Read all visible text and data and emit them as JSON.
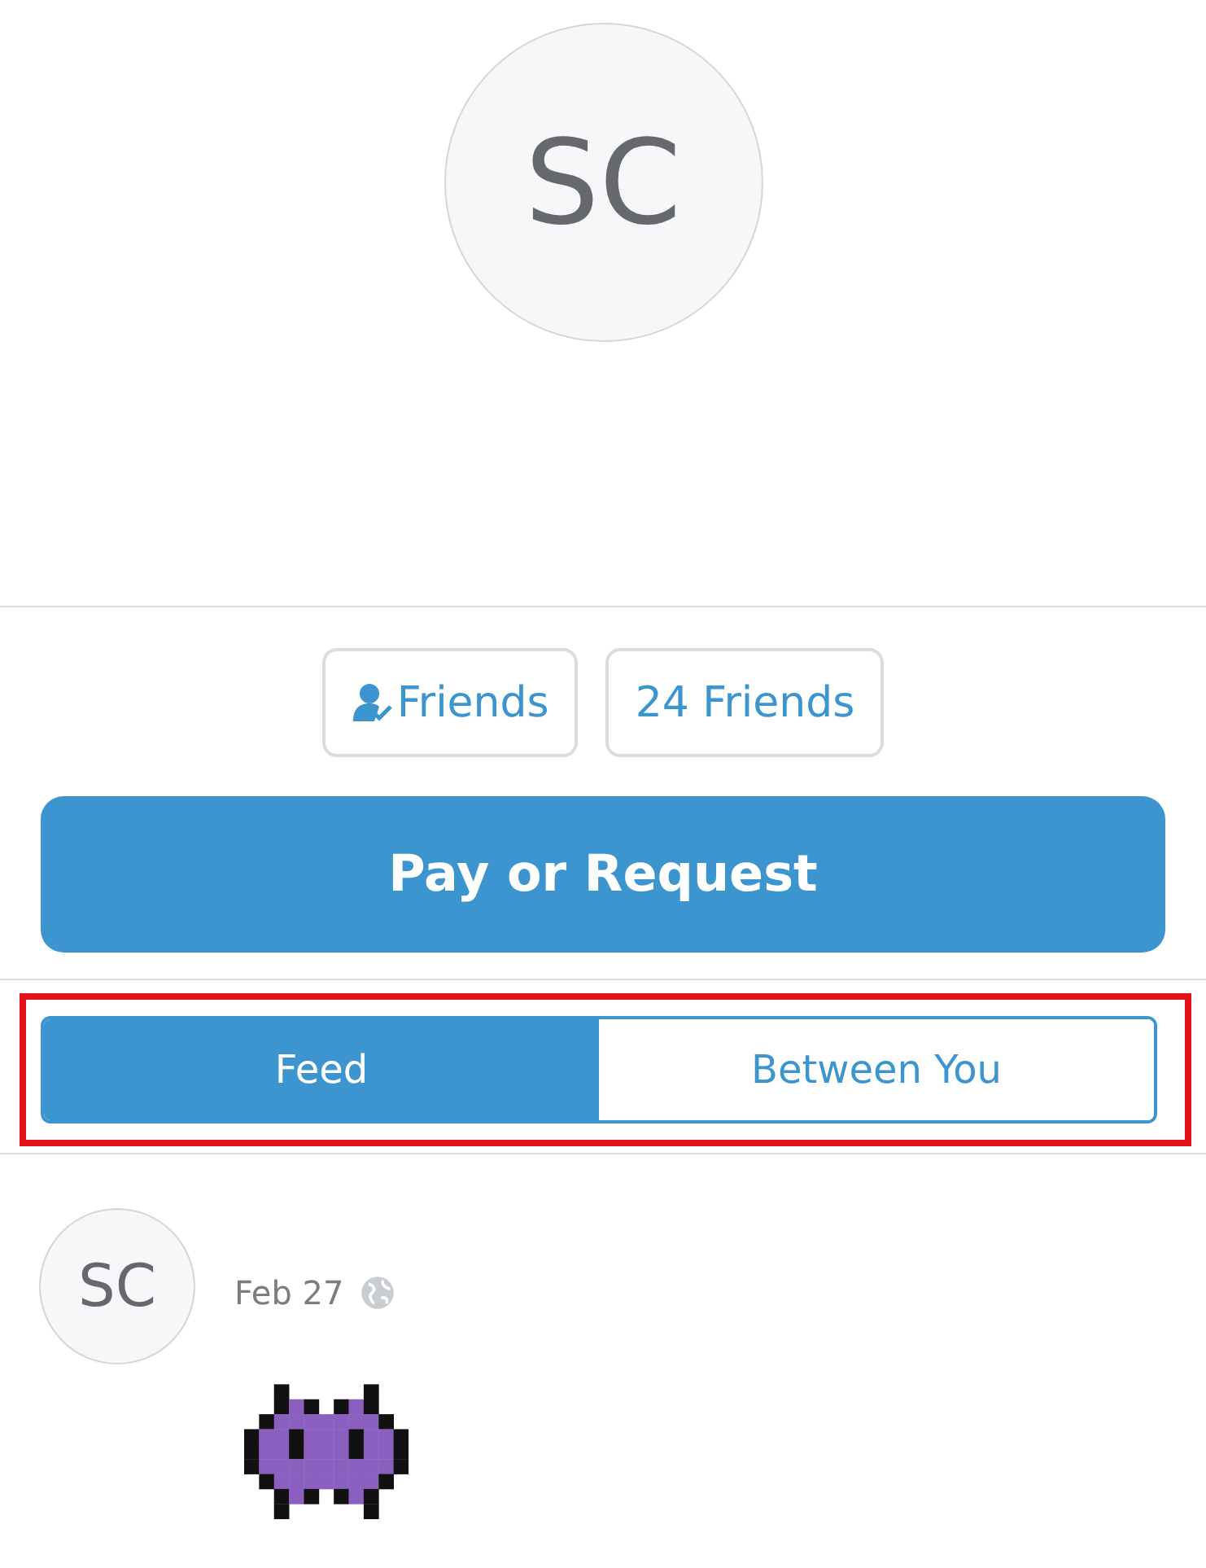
{
  "profile": {
    "initials": "SC"
  },
  "friend_buttons": [
    {
      "kind": "status",
      "label": "Friends"
    },
    {
      "kind": "count",
      "label": "24 Friends"
    }
  ],
  "primary_button": "Pay or Request",
  "tabs": [
    {
      "label": "Feed",
      "selected": true
    },
    {
      "label": "Between You",
      "selected": false
    }
  ],
  "feed": [
    {
      "initials": "SC",
      "date": "Feb 27",
      "public": true
    }
  ]
}
